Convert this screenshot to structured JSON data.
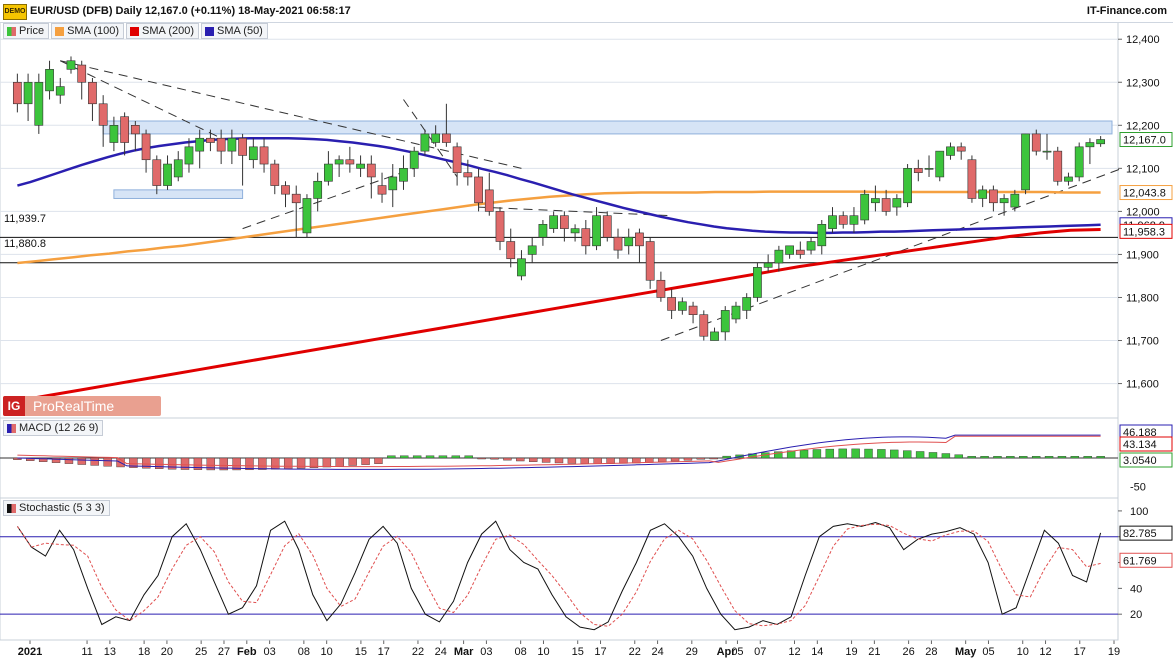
{
  "header": {
    "logo_text": "DEMO",
    "title": "EUR/USD (DFB) Daily 12,167.0 (+0.11%) 18-May-2021 06:58:17",
    "brand": "IT-Finance.com"
  },
  "legend": [
    {
      "label": "Price",
      "color": "#22aa22"
    },
    {
      "label": "SMA (100)",
      "color": "#f5a040"
    },
    {
      "label": "SMA (200)",
      "color": "#e00000"
    },
    {
      "label": "SMA (50)",
      "color": "#2a1fb0"
    }
  ],
  "watermark": "ProRealTime",
  "watermark_badge": "IG",
  "levels": {
    "upper": "11,939.7",
    "lower": "11,880.8"
  },
  "macd_label": "MACD (12 26 9)",
  "stoch_label": "Stochastic (5 3 3)",
  "colors": {
    "up": "#3cc43c",
    "down": "#e06a6a",
    "sma50": "#2a1fb0",
    "sma100": "#f5a040",
    "sma200": "#e00000",
    "zone": "#d6e4f6",
    "grid": "#dde3ec"
  },
  "chart_data": [
    {
      "type": "candlestick",
      "title": "EUR/USD (DFB) Daily",
      "ylim": [
        11520,
        12440
      ],
      "y_ticks": [
        "12,400",
        "12,300",
        "12,200",
        "12,100",
        "12,000",
        "11,900",
        "11,800",
        "11,700",
        "11,600"
      ],
      "x_tick_labels": [
        "2021",
        "11",
        "13",
        "18",
        "20",
        "25",
        "27",
        "Feb",
        "03",
        "08",
        "10",
        "15",
        "17",
        "22",
        "24",
        "Mar",
        "03",
        "08",
        "10",
        "15",
        "17",
        "22",
        "24",
        "29",
        "Apr",
        "05",
        "07",
        "12",
        "14",
        "19",
        "21",
        "26",
        "28",
        "May",
        "05",
        "10",
        "12",
        "17",
        "19"
      ],
      "price_tags": [
        {
          "label": "12,167.0",
          "value": 12167,
          "color": "#2ea02e"
        },
        {
          "label": "12,043.8",
          "value": 12043.8,
          "color": "#f5a040"
        },
        {
          "label": "11,968.9",
          "value": 11968.9,
          "color": "#2a1fb0"
        },
        {
          "label": "11,958.3",
          "value": 11958.3,
          "color": "#e00000"
        }
      ],
      "candles": [
        [
          12300,
          12250,
          12320,
          12230
        ],
        [
          12250,
          12300,
          12320,
          12210
        ],
        [
          12200,
          12300,
          12320,
          12180
        ],
        [
          12280,
          12330,
          12350,
          12260
        ],
        [
          12270,
          12290,
          12310,
          12250
        ],
        [
          12330,
          12350,
          12360,
          12320
        ],
        [
          12340,
          12300,
          12350,
          12260
        ],
        [
          12300,
          12250,
          12310,
          12210
        ],
        [
          12250,
          12200,
          12270,
          12150
        ],
        [
          12160,
          12200,
          12220,
          12140
        ],
        [
          12220,
          12160,
          12230,
          12130
        ],
        [
          12200,
          12180,
          12210,
          12140
        ],
        [
          12180,
          12120,
          12190,
          12090
        ],
        [
          12120,
          12060,
          12130,
          12040
        ],
        [
          12060,
          12110,
          12130,
          12050
        ],
        [
          12080,
          12120,
          12140,
          12070
        ],
        [
          12110,
          12150,
          12170,
          12090
        ],
        [
          12140,
          12170,
          12190,
          12100
        ],
        [
          12170,
          12160,
          12190,
          12140
        ],
        [
          12170,
          12140,
          12190,
          12110
        ],
        [
          12140,
          12170,
          12190,
          12110
        ],
        [
          12170,
          12130,
          12180,
          12060
        ],
        [
          12120,
          12150,
          12170,
          12100
        ],
        [
          12150,
          12110,
          12170,
          12090
        ],
        [
          12110,
          12060,
          12120,
          12040
        ],
        [
          12060,
          12040,
          12070,
          12010
        ],
        [
          12040,
          12020,
          12060,
          11940
        ],
        [
          11950,
          12030,
          12040,
          11940
        ],
        [
          12030,
          12070,
          12090,
          12000
        ],
        [
          12070,
          12110,
          12140,
          12060
        ],
        [
          12110,
          12120,
          12130,
          12080
        ],
        [
          12120,
          12110,
          12150,
          12090
        ],
        [
          12100,
          12110,
          12130,
          12080
        ],
        [
          12110,
          12080,
          12130,
          12030
        ],
        [
          12060,
          12040,
          12090,
          12020
        ],
        [
          12050,
          12080,
          12110,
          12010
        ],
        [
          12070,
          12100,
          12130,
          12050
        ],
        [
          12100,
          12140,
          12150,
          12080
        ],
        [
          12140,
          12180,
          12190,
          12130
        ],
        [
          12160,
          12180,
          12200,
          12150
        ],
        [
          12180,
          12160,
          12250,
          12150
        ],
        [
          12150,
          12090,
          12160,
          12060
        ],
        [
          12090,
          12080,
          12120,
          12060
        ],
        [
          12080,
          12020,
          12100,
          12000
        ],
        [
          12050,
          12000,
          12090,
          11990
        ],
        [
          12000,
          11930,
          12010,
          11910
        ],
        [
          11930,
          11890,
          11960,
          11870
        ],
        [
          11850,
          11890,
          11910,
          11840
        ],
        [
          11900,
          11920,
          11940,
          11880
        ],
        [
          11940,
          11970,
          11980,
          11920
        ],
        [
          11960,
          11990,
          12000,
          11950
        ],
        [
          11990,
          11960,
          12000,
          11930
        ],
        [
          11950,
          11960,
          11970,
          11930
        ],
        [
          11960,
          11920,
          11980,
          11900
        ],
        [
          11920,
          11990,
          12010,
          11910
        ],
        [
          11990,
          11940,
          12000,
          11930
        ],
        [
          11940,
          11910,
          11960,
          11890
        ],
        [
          11920,
          11940,
          11960,
          11900
        ],
        [
          11950,
          11920,
          11960,
          11880
        ],
        [
          11930,
          11840,
          11940,
          11820
        ],
        [
          11840,
          11800,
          11860,
          11790
        ],
        [
          11800,
          11770,
          11820,
          11750
        ],
        [
          11770,
          11790,
          11800,
          11760
        ],
        [
          11780,
          11760,
          11790,
          11740
        ],
        [
          11760,
          11710,
          11770,
          11700
        ],
        [
          11700,
          11720,
          11730,
          11700
        ],
        [
          11720,
          11770,
          11780,
          11700
        ],
        [
          11750,
          11780,
          11790,
          11740
        ],
        [
          11770,
          11800,
          11810,
          11750
        ],
        [
          11800,
          11870,
          11880,
          11790
        ],
        [
          11870,
          11880,
          11900,
          11860
        ],
        [
          11880,
          11910,
          11920,
          11860
        ],
        [
          11900,
          11920,
          11920,
          11890
        ],
        [
          11910,
          11900,
          11930,
          11890
        ],
        [
          11910,
          11930,
          11940,
          11900
        ],
        [
          11920,
          11970,
          11980,
          11900
        ],
        [
          11960,
          11990,
          12010,
          11950
        ],
        [
          11990,
          11970,
          12000,
          11960
        ],
        [
          11970,
          11990,
          12010,
          11950
        ],
        [
          11980,
          12040,
          12050,
          11970
        ],
        [
          12020,
          12030,
          12060,
          12000
        ],
        [
          12030,
          12000,
          12050,
          11990
        ],
        [
          12010,
          12030,
          12040,
          11990
        ],
        [
          12020,
          12100,
          12110,
          12010
        ],
        [
          12100,
          12090,
          12120,
          12070
        ],
        [
          12100,
          12100,
          12130,
          12080
        ],
        [
          12080,
          12140,
          12140,
          12070
        ],
        [
          12130,
          12150,
          12160,
          12120
        ],
        [
          12150,
          12140,
          12160,
          12120
        ],
        [
          12120,
          12030,
          12130,
          12020
        ],
        [
          12030,
          12050,
          12060,
          12010
        ],
        [
          12050,
          12020,
          12060,
          12000
        ],
        [
          12020,
          12030,
          12040,
          11990
        ],
        [
          12010,
          12040,
          12050,
          12000
        ],
        [
          12050,
          12180,
          12180,
          12040
        ],
        [
          12180,
          12140,
          12190,
          12130
        ],
        [
          12140,
          12140,
          12180,
          12120
        ],
        [
          12140,
          12070,
          12150,
          12060
        ],
        [
          12070,
          12080,
          12090,
          12060
        ],
        [
          12080,
          12150,
          12160,
          12070
        ],
        [
          12150,
          12160,
          12170,
          12110
        ],
        [
          12157,
          12167,
          12175,
          12150
        ]
      ],
      "sma_50": [
        12060,
        12068,
        12078,
        12088,
        12098,
        12108,
        12117,
        12126,
        12134,
        12141,
        12147,
        12152,
        12156,
        12160,
        12163,
        12166,
        12168,
        12169,
        12170,
        12170,
        12170,
        12170,
        12169,
        12168,
        12166,
        12163,
        12160,
        12156,
        12152,
        12147,
        12141,
        12135,
        12128,
        12121,
        12114,
        12107,
        12099,
        12092,
        12084,
        12075,
        12067,
        12058,
        12049,
        12040,
        12032,
        12024,
        12016,
        12008,
        12001,
        11994,
        11987,
        11981,
        11975,
        11970,
        11965,
        11961,
        11958,
        11955,
        11953,
        11952,
        11951,
        11951,
        11950,
        11950,
        11951,
        11951,
        11952,
        11953,
        11953,
        11954,
        11955,
        11956,
        11957,
        11958,
        11959,
        11960,
        11961,
        11962,
        11963,
        11964,
        11965,
        11966,
        11967,
        11968,
        11969
      ],
      "sma_100": [
        11880,
        11884,
        11889,
        11893,
        11898,
        11902,
        11907,
        11911,
        11916,
        11920,
        11926,
        11932,
        11938,
        11944,
        11950,
        11956,
        11962,
        11968,
        11974,
        11980,
        11986,
        11992,
        11998,
        12004,
        12010,
        12016,
        12021,
        12026,
        12030,
        12034,
        12037,
        12040,
        12042,
        12043,
        12044,
        12044,
        12044,
        12044,
        12045,
        12045,
        12045,
        12046,
        12046,
        12046,
        12046,
        12046,
        12046,
        12045,
        12045,
        12045,
        12045,
        12045,
        12045,
        12045,
        12045,
        12045,
        12045,
        12044,
        12044,
        12044
      ],
      "sma_200": [
        11560,
        11572,
        11584,
        11596,
        11608,
        11620,
        11632,
        11644,
        11656,
        11668,
        11680,
        11692,
        11704,
        11716,
        11728,
        11740,
        11752,
        11764,
        11776,
        11788,
        11800,
        11812,
        11824,
        11836,
        11848,
        11860,
        11872,
        11882,
        11892,
        11902,
        11912,
        11922,
        11932,
        11942,
        11950,
        11956,
        11958
      ],
      "levels": [
        11939.7,
        11880.8
      ]
    },
    {
      "type": "bar",
      "title": "MACD (12 26 9)",
      "ylim": [
        -70,
        70
      ],
      "y_ticks": [
        "-50"
      ],
      "price_tags": [
        {
          "label": "46.188",
          "value": 46.188,
          "color": "#2a1fb0"
        },
        {
          "label": "43.134",
          "value": 43.134,
          "color": "#e00000"
        },
        {
          "label": "3.0540",
          "value": 3.054,
          "color": "#2ea02e"
        }
      ]
    },
    {
      "type": "line",
      "title": "Stochastic (5 3 3)",
      "ylim": [
        0,
        110
      ],
      "y_ticks": [
        "100",
        "80",
        "60",
        "40",
        "20"
      ],
      "price_tags": [
        {
          "label": "82.785",
          "value": 82.785,
          "color": "#111111"
        },
        {
          "label": "61.769",
          "value": 61.769,
          "color": "#e05050"
        }
      ]
    }
  ]
}
